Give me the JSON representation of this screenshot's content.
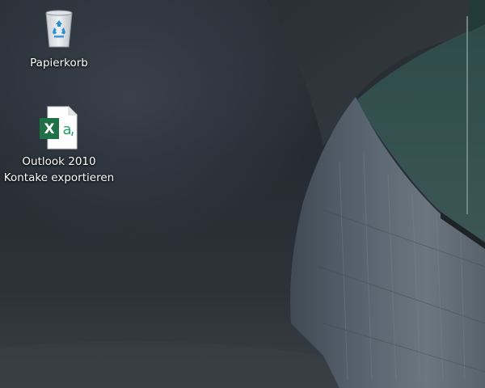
{
  "desktop": {
    "icons": [
      {
        "label": "Papierkorb",
        "icon": "recycle-bin-icon"
      },
      {
        "label_line1": "Outlook 2010",
        "label_line2": "Kontake exportieren",
        "icon": "excel-file-icon"
      }
    ]
  },
  "colors": {
    "excel_green": "#1e7145",
    "excel_letter_green": "#21a366",
    "recycle_blue": "#2b8fd6"
  }
}
